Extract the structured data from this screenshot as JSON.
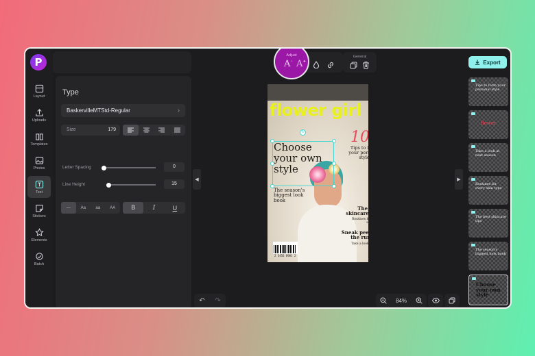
{
  "rail": {
    "logo_letter": "P",
    "items": [
      {
        "label": "Layout"
      },
      {
        "label": "Uploads"
      },
      {
        "label": "Templates"
      },
      {
        "label": "Photos"
      },
      {
        "label": "Text"
      },
      {
        "label": "Stickers"
      },
      {
        "label": "Elements"
      },
      {
        "label": "Batch"
      }
    ]
  },
  "panel": {
    "title": "Type",
    "font": "BaskervilleMTStd-Regular",
    "size_label": "Size",
    "size_value": "179",
    "letter_spacing_label": "Letter Spacing",
    "letter_spacing_value": "0",
    "letter_spacing_fraction": 0.0,
    "line_height_label": "Line Height",
    "line_height_value": "15",
    "line_height_fraction": 0.05,
    "case_options": [
      "—",
      "Aa",
      "aa",
      "AA"
    ],
    "style_options": [
      "B",
      "I",
      "U"
    ]
  },
  "toolbar": {
    "adjust_label": "Adjust",
    "general_label": "General",
    "export_label": "Export"
  },
  "cover": {
    "title": "flower girl",
    "headline": "Choose your own style",
    "sub_headline": "The season's biggest look book",
    "ten": "10",
    "ten_text": "Tips to form your personal style",
    "skincare_title": "The best skincare tips",
    "skincare_sub": "Routines for every skin type",
    "runway_title": "Sneak peek on the runway",
    "runway_sub": "Take a look at next season",
    "barcode_num": "2 3456  8901 2"
  },
  "zoom": {
    "value": "84%"
  },
  "thumbnails": [
    {
      "text": "Tips to form your personal style"
    },
    {
      "text": "flower"
    },
    {
      "text": "Take a look at next season"
    },
    {
      "text": "Routines for every skin type"
    },
    {
      "text": "The best skincare tips"
    },
    {
      "text": "The season's biggest look book"
    },
    {
      "text": "Choose your own style"
    }
  ],
  "colors": {
    "accent_magenta": "#9b17a6",
    "export_bg": "#8ff0ec",
    "title_yellow": "#e8f020",
    "ten_pink": "#e64a5c",
    "selection": "#43d6d2"
  }
}
